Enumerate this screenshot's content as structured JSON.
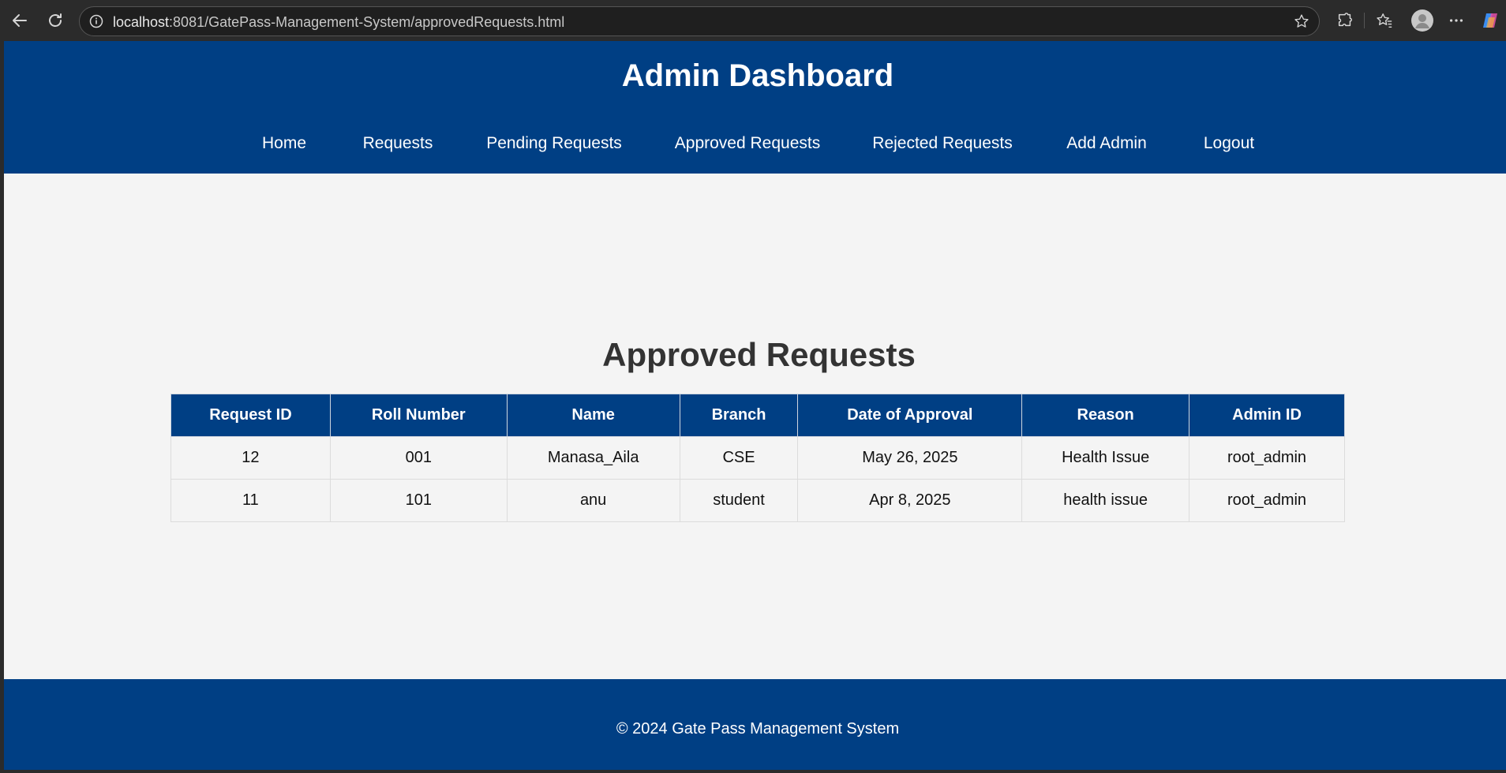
{
  "browser": {
    "url_host": "localhost",
    "url_rest": ":8081/GatePass-Management-System/approvedRequests.html"
  },
  "header": {
    "title": "Admin Dashboard",
    "nav": [
      "Home",
      "Requests",
      "Pending Requests",
      "Approved Requests",
      "Rejected Requests",
      "Add Admin",
      "Logout"
    ]
  },
  "main": {
    "title": "Approved Requests",
    "columns": [
      "Request ID",
      "Roll Number",
      "Name",
      "Branch",
      "Date of Approval",
      "Reason",
      "Admin ID"
    ],
    "rows": [
      [
        "12",
        "001",
        "Manasa_Aila",
        "CSE",
        "May 26, 2025",
        "Health Issue",
        "root_admin"
      ],
      [
        "11",
        "101",
        "anu",
        "student",
        "Apr 8, 2025",
        "health issue",
        "root_admin"
      ]
    ]
  },
  "footer": {
    "text": "© 2024 Gate Pass Management System"
  }
}
